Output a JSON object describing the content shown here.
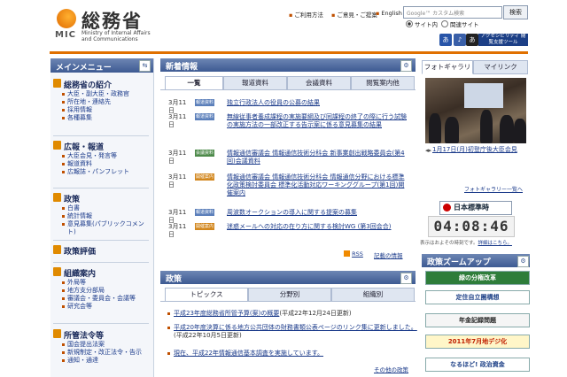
{
  "header": {
    "site_title": "総務省",
    "logo_mic": "MIC",
    "site_en_1": "Ministry of Internal Affairs",
    "site_en_2": "and Communications",
    "links": [
      "ご利用方法",
      "ご意見・ご提案",
      "English"
    ],
    "search_placeholder": "Google™ カスタム検索",
    "search_button": "検索",
    "radio_site": "サイト内",
    "radio_related": "関連サイト",
    "access_tool": "アクセシビリティ 閲覧支援ツール"
  },
  "main_menu": {
    "title": "メインメニュー",
    "sections": [
      {
        "title": "総務省の紹介",
        "items": [
          "大臣・副大臣・政務官",
          "所在地・連絡先",
          "採用情報",
          "各種募集"
        ]
      },
      {
        "title": "広報・報道",
        "items": [
          "大臣会見・発言等",
          "報道資料",
          "広報誌・パンフレット"
        ]
      },
      {
        "title": "政策",
        "items": [
          "白書",
          "統計情報",
          "意見募集(パブリックコメント)"
        ]
      },
      {
        "title": "政策評価",
        "items": []
      },
      {
        "title": "組織案内",
        "items": [
          "外局等",
          "地方支分部局",
          "審議会・委員会・会議等",
          "研究会等"
        ]
      },
      {
        "title": "所管法令等",
        "items": [
          "国会提出法案",
          "新規制定・改正法令・告示",
          "通知・通達"
        ]
      }
    ]
  },
  "news": {
    "title": "新着情報",
    "tabs": [
      "一覧",
      "報道資料",
      "会議資料",
      "閲覧案内他"
    ],
    "rows": [
      {
        "date": "3月11日",
        "badge": "報道資料",
        "badge_color": "blue",
        "text": "独立行政法人の役員の公募の結果"
      },
      {
        "date": "3月11日",
        "badge": "報道資料",
        "badge_color": "blue",
        "text": "無線従事者養成課程の実施要綱及び同課程の終了の際に行う試験の実施方法の一部改正する告示案に係る意見募集の結果"
      },
      {
        "date": "3月11日",
        "badge": "会議資料",
        "badge_color": "green",
        "text": "情報通信審議会 情報通信技術分科会 新事業創出戦略委員会(第4回)会議資料"
      },
      {
        "date": "3月11日",
        "badge": "開催案内",
        "badge_color": "orange",
        "text": "情報通信審議会 情報通信技術分科会 情報通信分野における標準化政策検討委員会 標準化活動対応ワーキンググループ(第1回)開催案内"
      },
      {
        "date": "3月11日",
        "badge": "報道資料",
        "badge_color": "blue",
        "text": "周波数オークションの導入に関する提案の募集"
      },
      {
        "date": "3月11日",
        "badge": "開催案内",
        "badge_color": "orange",
        "text": "迷惑メールへの対応の在り方に関する検討WG (第3回会合)"
      }
    ],
    "rss": "RSS",
    "past": "記載の情報"
  },
  "policy": {
    "title": "政策",
    "tabs": [
      "トピックス",
      "分野別",
      "組織別"
    ],
    "rows": [
      {
        "link": "平成23年度総務省所管予算(案)の概要",
        "note": "(平成22年12月24日更新)"
      },
      {
        "link": "平成20年度決算に係る地方公共団体の財務書類公表ページのリンク集に更新しました。",
        "note": "(平成22年10月5日更新)"
      },
      {
        "link": "現在、平成22年情報通信基本調査を実施しています。",
        "note": ""
      }
    ],
    "more": "その他の政策"
  },
  "right": {
    "tabs": [
      "フォトギャラリー",
      "マイリンク"
    ],
    "photo_caption": "1月17日(月)初登庁後大臣会見",
    "photo_more": "フォトギャラリー一覧へ",
    "jst_label": "日本標準時",
    "clock": "04:08:46",
    "clock_note": "表示はおよその時刻です。",
    "clock_note_link": "詳細はこちら。",
    "zoom_title": "政策ズームアップ",
    "zoom_banners": [
      "緑の分権改革",
      "定住自立圏構想",
      "年金記録問題",
      "2011年7月地デジ化",
      "なるほど! 政治資金"
    ]
  }
}
